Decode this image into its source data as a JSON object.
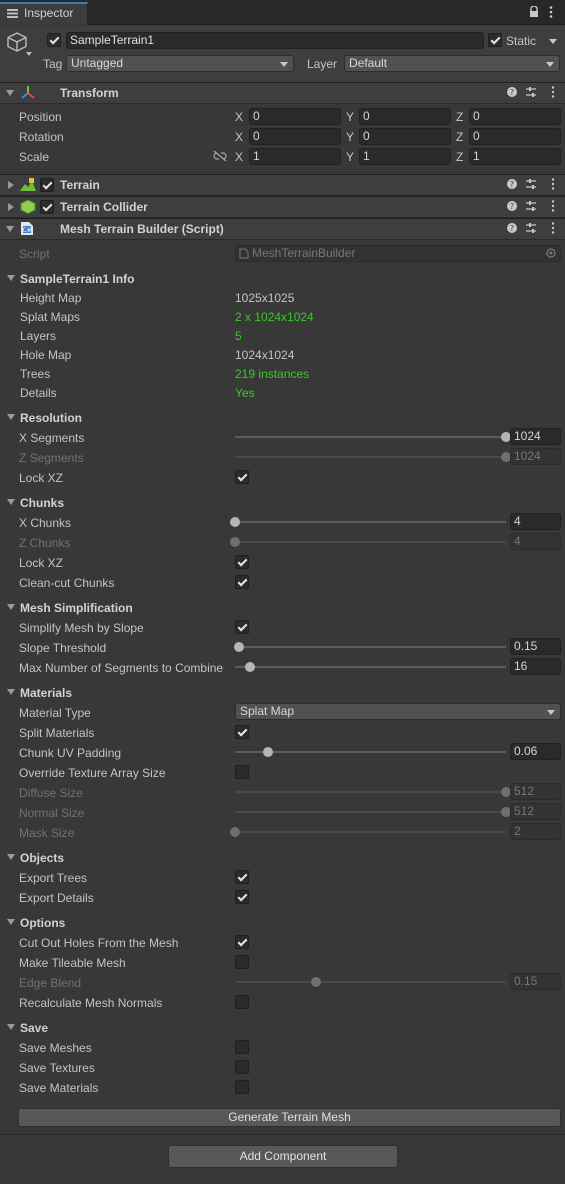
{
  "window": {
    "tab_label": "Inspector"
  },
  "gameobject": {
    "name": "SampleTerrain1",
    "static_label": "Static",
    "tag_label": "Tag",
    "tag_value": "Untagged",
    "layer_label": "Layer",
    "layer_value": "Default"
  },
  "components": {
    "transform": "Transform",
    "terrain": "Terrain",
    "collider": "Terrain Collider",
    "script": "Mesh Terrain Builder (Script)"
  },
  "transform": {
    "position_label": "Position",
    "rotation_label": "Rotation",
    "scale_label": "Scale",
    "x": "X",
    "y": "Y",
    "z": "Z",
    "position": [
      "0",
      "0",
      "0"
    ],
    "rotation": [
      "0",
      "0",
      "0"
    ],
    "scale": [
      "1",
      "1",
      "1"
    ]
  },
  "script_row": {
    "label": "Script",
    "value": "MeshTerrainBuilder"
  },
  "info": {
    "header": "SampleTerrain1 Info",
    "height_map_label": "Height Map",
    "height_map": "1025x1025",
    "splat_label": "Splat Maps",
    "splat": "2 x 1024x1024",
    "layers_label": "Layers",
    "layers": "5",
    "hole_label": "Hole Map",
    "hole": "1024x1024",
    "trees_label": "Trees",
    "trees": "219 instances",
    "details_label": "Details",
    "details": "Yes"
  },
  "resolution": {
    "header": "Resolution",
    "x_label": "X Segments",
    "x_value": "1024",
    "x_level": 1.0,
    "z_label": "Z Segments",
    "z_value": "1024",
    "z_level": 1.0,
    "lock_label": "Lock XZ",
    "lock": true
  },
  "chunks": {
    "header": "Chunks",
    "x_label": "X Chunks",
    "x_value": "4",
    "x_level": 0.0,
    "z_label": "Z Chunks",
    "z_value": "4",
    "z_level": 0.0,
    "lock_label": "Lock XZ",
    "lock": true,
    "clean_label": "Clean-cut Chunks",
    "clean": true
  },
  "simplification": {
    "header": "Mesh Simplification",
    "simplify_label": "Simplify Mesh by Slope",
    "simplify": true,
    "slope_label": "Slope Threshold",
    "slope_value": "0.15",
    "slope_level": 0.015,
    "max_label": "Max Number of Segments to Combine",
    "max_value": "16",
    "max_level": 0.055
  },
  "materials": {
    "header": "Materials",
    "type_label": "Material Type",
    "type_value": "Splat Map",
    "split_label": "Split Materials",
    "split": true,
    "uv_label": "Chunk UV Padding",
    "uv_value": "0.06",
    "uv_level": 0.12,
    "override_label": "Override Texture Array Size",
    "override": false,
    "diffuse_label": "Diffuse Size",
    "diffuse_value": "512",
    "diffuse_level": 1.0,
    "normal_label": "Normal Size",
    "normal_value": "512",
    "normal_level": 1.0,
    "mask_label": "Mask Size",
    "mask_value": "2",
    "mask_level": 0.0
  },
  "objects": {
    "header": "Objects",
    "trees_label": "Export Trees",
    "trees": true,
    "details_label": "Export Details",
    "details": true
  },
  "options": {
    "header": "Options",
    "holes_label": "Cut Out Holes From the Mesh",
    "holes": true,
    "tileable_label": "Make Tileable Mesh",
    "tileable": false,
    "blend_label": "Edge Blend",
    "blend_value": "0.15",
    "blend_level": 0.3,
    "normals_label": "Recalculate Mesh Normals",
    "normals": false
  },
  "save": {
    "header": "Save",
    "meshes_label": "Save Meshes",
    "meshes": false,
    "textures_label": "Save Textures",
    "textures": false,
    "materials_label": "Save Materials",
    "materials": false
  },
  "buttons": {
    "generate": "Generate Terrain Mesh",
    "add_component": "Add Component"
  }
}
